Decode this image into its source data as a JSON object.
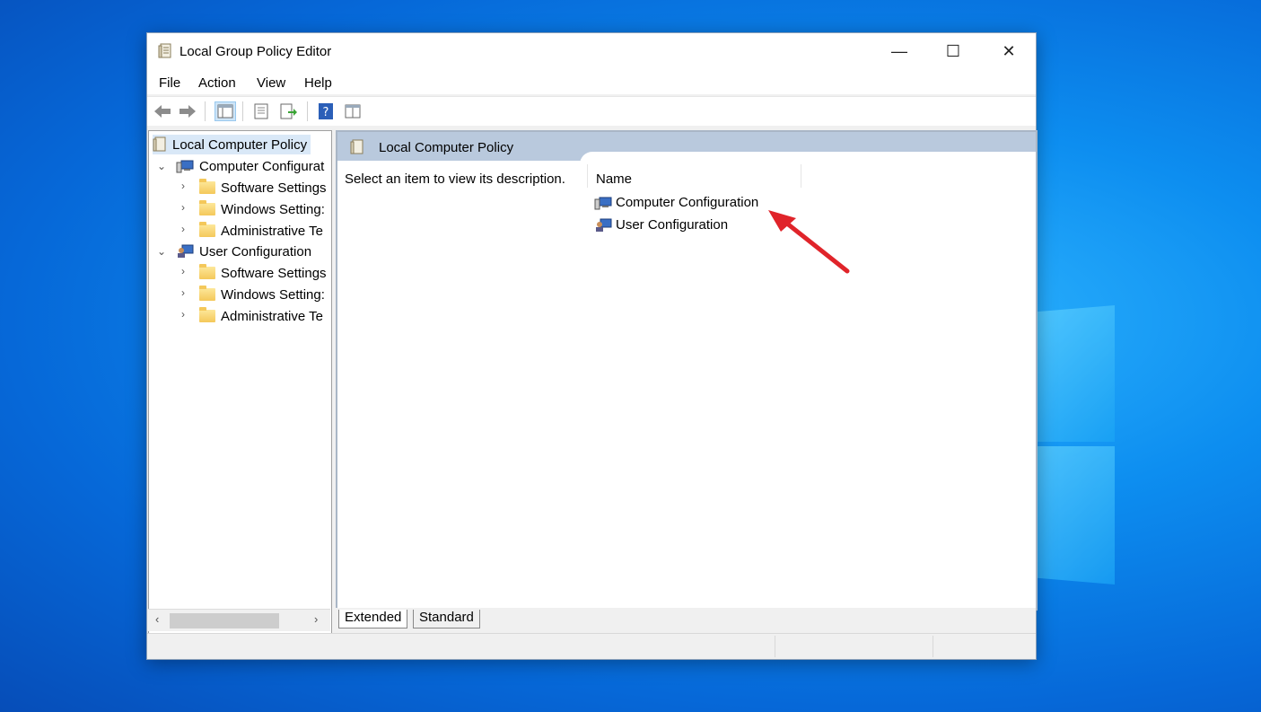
{
  "window": {
    "title": "Local Group Policy Editor",
    "minimize": "—",
    "maximize": "☐",
    "close": "✕"
  },
  "menu": [
    "File",
    "Action",
    "View",
    "Help"
  ],
  "tree": {
    "root": "Local Computer Policy",
    "computer": {
      "label": "Computer Configurat",
      "children": [
        "Software Settings",
        "Windows Setting:",
        "Administrative Te"
      ]
    },
    "user": {
      "label": "User Configuration",
      "children": [
        "Software Settings",
        "Windows Setting:",
        "Administrative Te"
      ]
    }
  },
  "main": {
    "header": "Local Computer Policy",
    "description": "Select an item to view its description.",
    "column_name": "Name",
    "items": [
      "Computer Configuration",
      "User Configuration"
    ]
  },
  "tabs": [
    "Extended",
    "Standard"
  ],
  "annotation_color": "#e0242a"
}
